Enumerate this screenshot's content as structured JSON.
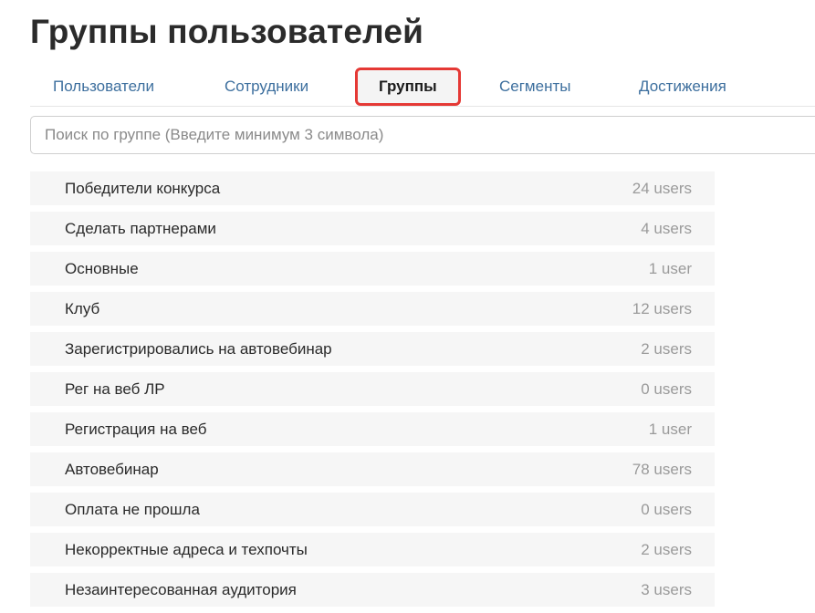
{
  "page": {
    "title": "Группы пользователей"
  },
  "tabs": [
    {
      "label": "Пользователи",
      "active": false
    },
    {
      "label": "Сотрудники",
      "active": false
    },
    {
      "label": "Группы",
      "active": true
    },
    {
      "label": "Сегменты",
      "active": false
    },
    {
      "label": "Достижения",
      "active": false
    }
  ],
  "search": {
    "placeholder": "Поиск по группе (Введите минимум 3 символа)",
    "value": ""
  },
  "groups": [
    {
      "name": "Победители конкурса",
      "count": "24 users"
    },
    {
      "name": "Сделать партнерами",
      "count": "4 users"
    },
    {
      "name": "Основные",
      "count": "1 user"
    },
    {
      "name": "Клуб",
      "count": "12 users"
    },
    {
      "name": "Зарегистрировались на автовебинар",
      "count": "2 users"
    },
    {
      "name": "Рег на веб ЛР",
      "count": "0 users"
    },
    {
      "name": "Регистрация на веб",
      "count": "1 user"
    },
    {
      "name": "Автовебинар",
      "count": "78 users"
    },
    {
      "name": "Оплата не прошла",
      "count": "0 users"
    },
    {
      "name": "Некорректные адреса и техпочты",
      "count": "2 users"
    },
    {
      "name": "Незаинтересованная аудитория",
      "count": "3 users"
    }
  ],
  "colors": {
    "tab_link": "#3d6f9e",
    "active_tab_highlight": "#e53935",
    "row_background": "#f6f6f6",
    "count_text": "#9a9a9a"
  }
}
